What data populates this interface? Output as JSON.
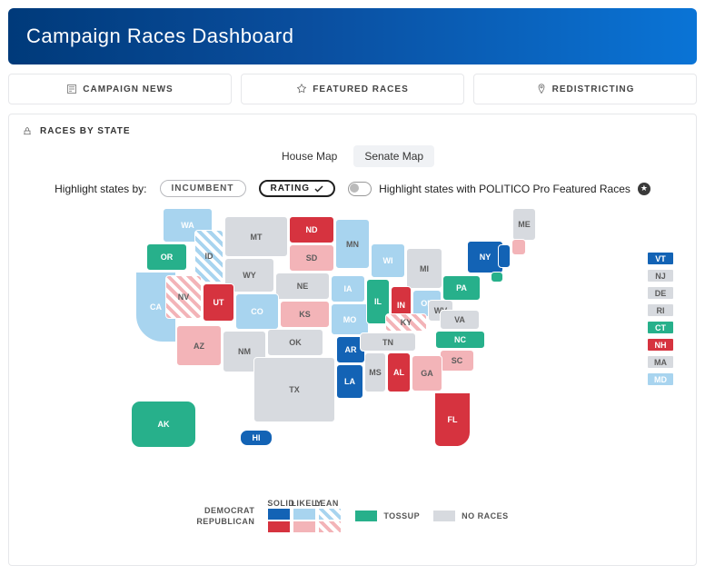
{
  "header": {
    "title": "Campaign Races Dashboard"
  },
  "tabs": {
    "news": "CAMPAIGN NEWS",
    "featured": "FEATURED RACES",
    "redistricting": "REDISTRICTING"
  },
  "panel": {
    "title": "RACES BY STATE"
  },
  "mapTabs": {
    "house": "House Map",
    "senate": "Senate Map",
    "active": "senate"
  },
  "controls": {
    "highlight_label": "Highlight states by:",
    "incumbent": "INCUMBENT",
    "rating": "RATING",
    "active": "rating",
    "featured_toggle_label": "Highlight states with POLITICO Pro Featured Races"
  },
  "legend": {
    "solid": "SOLID",
    "likely": "LIKELY",
    "lean": "LEAN",
    "democrat": "DEMOCRAT",
    "republican": "REPUBLICAN",
    "tossup": "TOSSUP",
    "noraces": "NO RACES"
  },
  "colors": {
    "dem_solid": "#1363b5",
    "dem_likely": "#a8d4ef",
    "rep_solid": "#d6333f",
    "rep_likely": "#f3b4b8",
    "tossup": "#27b08b",
    "none": "#d7dadf"
  },
  "states": {
    "WA": "dem_likely",
    "OR": "tossup",
    "CA": "dem_likely",
    "ID": "dem_lean",
    "MT": "none",
    "ND": "rep_solid",
    "SD": "rep_likely",
    "WY": "none",
    "NE": "none",
    "MN": "dem_likely",
    "WI": "dem_likely",
    "MI": "none",
    "IA": "dem_likely",
    "NV": "rep_lean",
    "UT": "rep_solid",
    "CO": "dem_likely",
    "KS": "rep_likely",
    "MO": "dem_likely",
    "IL": "tossup",
    "IN": "rep_solid",
    "OH": "dem_likely",
    "PA": "tossup",
    "NY": "dem_solid",
    "ME": "none",
    "AZ": "rep_likely",
    "NM": "none",
    "OK": "none",
    "TX": "none",
    "AR": "dem_solid",
    "LA": "dem_solid",
    "MS": "none",
    "AL": "rep_solid",
    "TN": "none",
    "KY": "rep_lean",
    "WV": "none",
    "VA": "none",
    "NC": "tossup",
    "SC": "rep_likely",
    "GA": "rep_likely",
    "FL": "rep_solid",
    "HI": "dem_solid",
    "AK": "tossup",
    "VT": "dem_solid",
    "NJ": "none",
    "DE": "none",
    "RI": "none",
    "CT": "tossup",
    "NH": "rep_solid",
    "MA": "none",
    "MD": "dem_likely"
  },
  "sideStates": [
    "VT",
    "NJ",
    "DE",
    "RI",
    "CT",
    "NH",
    "MA",
    "MD"
  ]
}
